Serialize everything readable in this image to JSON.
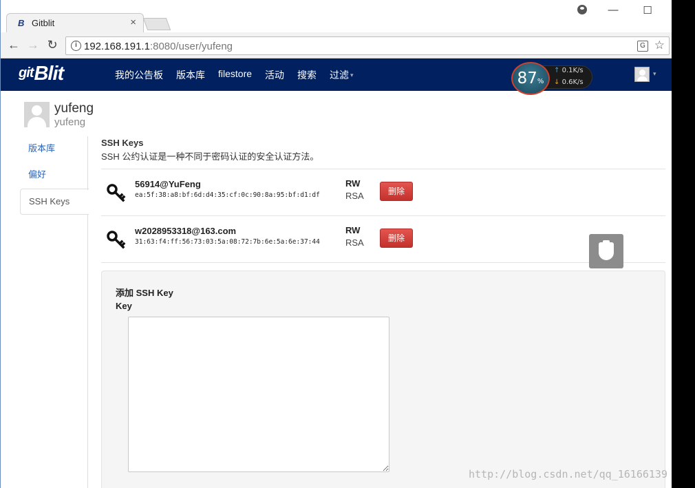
{
  "browser": {
    "tab_title": "Gitblit",
    "tab_favicon": "B",
    "close_glyph": "×",
    "url_host": "192.168.191.1",
    "url_rest": ":8080/user/yufeng",
    "info_glyph": "i",
    "translate_glyph": "G",
    "back_glyph": "←",
    "forward_glyph": "→",
    "reload_glyph": "↻",
    "star_glyph": "☆",
    "minimize_glyph": "—",
    "maximize_glyph": "☐"
  },
  "app": {
    "brand_prefix": "git",
    "brand": "Blit",
    "nav": [
      {
        "label": "我的公告板"
      },
      {
        "label": "版本库"
      },
      {
        "label": "filestore"
      },
      {
        "label": "活动"
      },
      {
        "label": "搜索"
      },
      {
        "label": "过滤",
        "caret": "▾"
      }
    ],
    "user_caret": "▾"
  },
  "speed_widget": {
    "percent": "87",
    "percent_unit": "%",
    "up_arrow": "↑",
    "up": "0.1",
    "down_arrow": "↓",
    "down": "0.6",
    "unit": "K/s"
  },
  "profile": {
    "display_name": "yufeng",
    "username": "yufeng"
  },
  "sidebar": {
    "items": [
      {
        "label": "版本库"
      },
      {
        "label": "偏好"
      },
      {
        "label": "SSH Keys"
      }
    ]
  },
  "ssh_keys": {
    "title": "SSH Keys",
    "description": "SSH 公约认证是一种不同于密码认证的安全认证方法。",
    "keys": [
      {
        "name": "56914@YuFeng",
        "fingerprint": "ea:5f:38:a8:bf:6d:d4:35:cf:0c:90:8a:95:bf:d1:df",
        "permission": "RW",
        "type": "RSA",
        "delete_label": "删除"
      },
      {
        "name": "w2028953318@163.com",
        "fingerprint": "31:63:f4:ff:56:73:03:5a:08:72:7b:6e:5a:6e:37:44",
        "permission": "RW",
        "type": "RSA",
        "delete_label": "删除"
      }
    ]
  },
  "add_key": {
    "title": "添加 SSH Key",
    "key_label": "Key",
    "key_value": ""
  },
  "watermark": "http://blog.csdn.net/qq_16166139",
  "colors": {
    "appbar": "#002060",
    "delete_button": "#d9443f",
    "link": "#2a62b8"
  }
}
